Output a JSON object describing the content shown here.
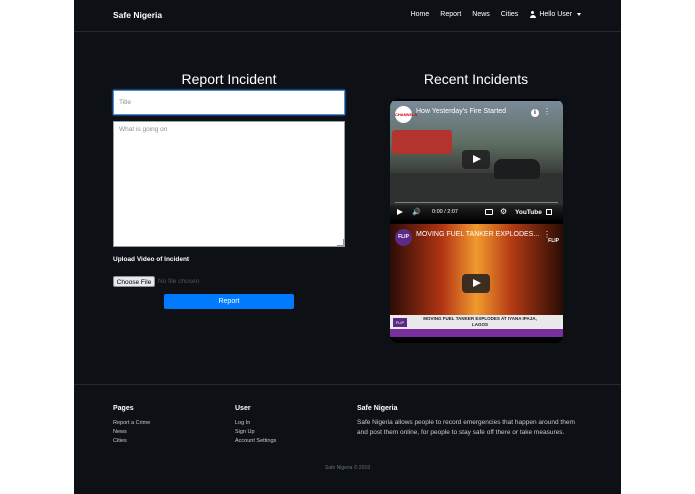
{
  "nav": {
    "brand": "Safe Nigeria",
    "links": [
      "Home",
      "Report",
      "News",
      "Cities"
    ],
    "user_label": "Hello User"
  },
  "report": {
    "heading": "Report Incident",
    "title_placeholder": "Title",
    "description_placeholder": "What is going on",
    "upload_label": "Upload Video of Incident",
    "choose_file_label": "Choose File",
    "no_file_text": "No file chosen",
    "submit_label": "Report"
  },
  "recent": {
    "heading": "Recent Incidents",
    "videos": [
      {
        "channel_logo_text": "CHANNELS",
        "title": "How Yesterday's Fire Started",
        "time": "0:00 / 2:07",
        "brand": "YouTube"
      },
      {
        "channel_logo_text": "FLIP",
        "title": "MOVING FUEL TANKER EXPLODES...",
        "overlay_tag": "FLIP",
        "caption": "MOVING FUEL TANKER EXPLODES AT IYANA IPAJA, LAGOS"
      }
    ]
  },
  "footer": {
    "pages_heading": "Pages",
    "pages_links": [
      "Report a Crime",
      "News",
      "Cities"
    ],
    "user_heading": "User",
    "user_links": [
      "Log In",
      "Sign Up",
      "Account Settings"
    ],
    "about_heading": "Safe Nigeria",
    "about_text": "Safe Nigeria allows people to record emergencies that happen around them and post them online, for people to stay safe off there or take measures.",
    "copyright": "Safe Nigeria © 2019"
  },
  "colors": {
    "background": "#0d1014",
    "primary_button": "#007bff",
    "page_margin": "#ffffff"
  }
}
